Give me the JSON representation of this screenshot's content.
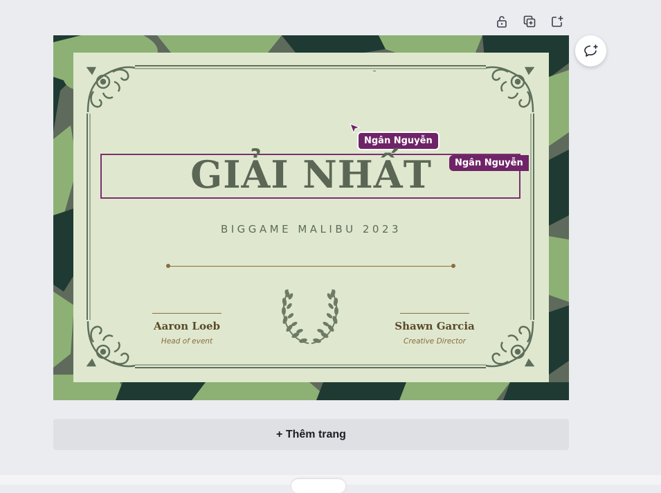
{
  "toolbar": {
    "lock_icon": "unlock-icon",
    "duplicate_icon": "duplicate-page-icon",
    "add_icon": "add-page-icon"
  },
  "comment": {
    "icon": "add-comment-icon"
  },
  "certificate": {
    "title": "GIẢI NHẤT",
    "subtitle": "BIGGAME MALIBU 2023",
    "signatures": [
      {
        "name": "Aaron Loeb",
        "role": "Head of event"
      },
      {
        "name": "Shawn Garcia",
        "role": "Creative Director"
      }
    ],
    "emblem": "laurel-wreath-icon"
  },
  "collaborators": {
    "box_tag": "Ngân Nguyễn",
    "cursor_tag": "Ngân Nguyễn"
  },
  "add_page": {
    "label": "+ Thêm trang"
  },
  "colors": {
    "background": "#ebecf0",
    "certificate_bg": "#dfe8cf",
    "ornament": "#5f6f5c",
    "accent_purple": "#6f2467",
    "gold": "#8b6b3e",
    "camo_light": "#8db174",
    "camo_dark": "#1f3a33",
    "camo_mid": "#5e6a5b"
  }
}
